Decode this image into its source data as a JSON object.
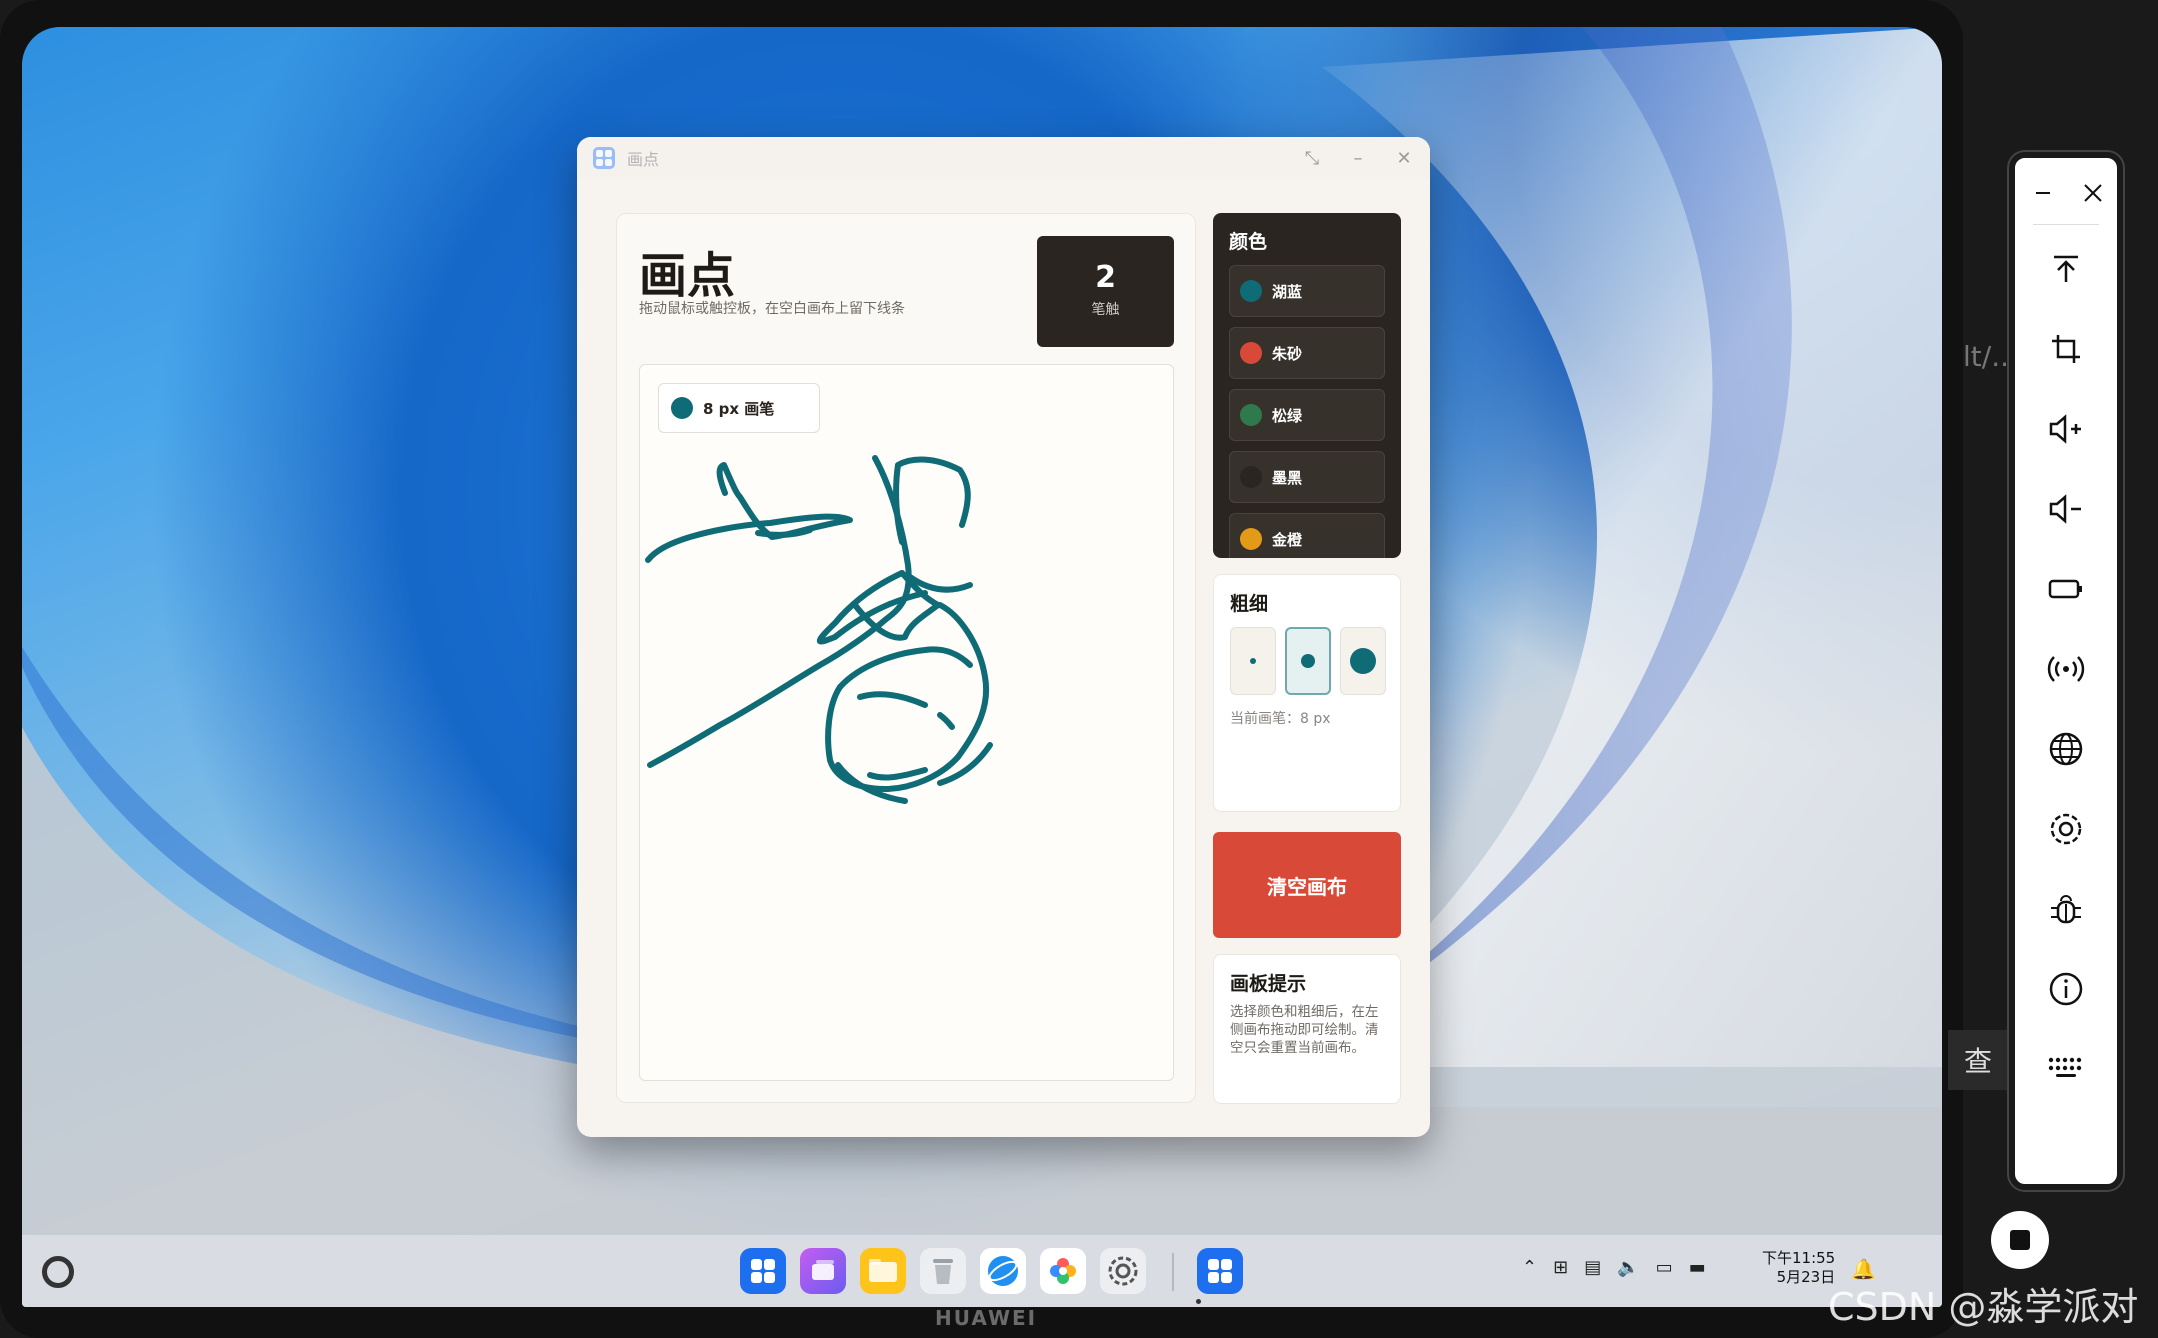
{
  "window": {
    "title": "画点",
    "controls": [
      "restore-icon",
      "minimize-icon",
      "close-icon"
    ]
  },
  "app": {
    "heading": "画点",
    "subtitle": "拖动鼠标或触控板，在空白画布上留下线条",
    "stroke_count": "2",
    "stroke_label": "笔触",
    "brush_chip": "8 px 画笔",
    "brush_color": "#0f6b76"
  },
  "colors": {
    "title": "颜色",
    "items": [
      {
        "name": "湖蓝",
        "hex": "#0f6b76"
      },
      {
        "name": "朱砂",
        "hex": "#d84a37"
      },
      {
        "name": "松绿",
        "hex": "#2f7a4d"
      },
      {
        "name": "墨黑",
        "hex": "#2a2520"
      },
      {
        "name": "金橙",
        "hex": "#e39a17"
      }
    ]
  },
  "widths": {
    "title": "粗细",
    "options": [
      "small",
      "medium",
      "large"
    ],
    "selected": "medium",
    "current": "当前画笔：8 px"
  },
  "clear_label": "清空画布",
  "tips": {
    "title": "画板提示",
    "body": "选择颜色和粗细后，在左侧画布拖动即可绘制。清空只会重置当前画布。"
  },
  "taskbar": {
    "apps": [
      "app-grid-icon",
      "multitask-icon",
      "files-icon",
      "trash-icon",
      "browser-icon",
      "gallery-icon",
      "settings-icon",
      "huapoint-icon"
    ],
    "tray": [
      "chevron-up-icon",
      "input-method-icon",
      "clipboard-icon",
      "volume-icon",
      "display-icon",
      "battery-icon"
    ],
    "time": "下午11:55",
    "date": "5月23日"
  },
  "device_brand": "HUAWEI",
  "side_toolbar": {
    "items": [
      "minimize-icon",
      "close-icon",
      "rotate-top-icon",
      "crop-icon",
      "volume-up-icon",
      "volume-down-icon",
      "battery-icon",
      "signal-icon",
      "globe-icon",
      "settings-icon",
      "bug-icon",
      "info-icon",
      "keyboard-icon"
    ]
  },
  "background_text": "lt/...",
  "background_search": "查",
  "watermark": "CSDN @淼学派对"
}
